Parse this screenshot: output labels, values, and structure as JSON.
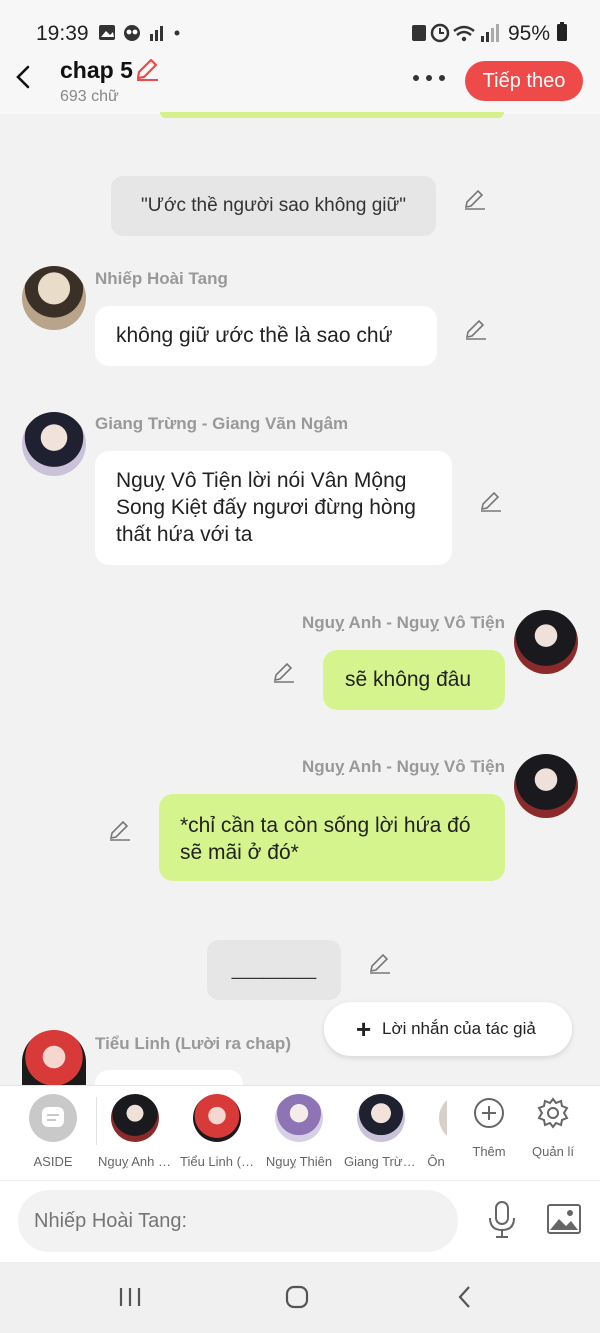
{
  "status_bar": {
    "time": "19:39",
    "battery": "95%"
  },
  "header": {
    "title": "chap 5",
    "word_count": "693 chữ",
    "next_label": "Tiếp theo"
  },
  "messages": [
    {
      "type": "narration",
      "text": "\"Ước thề người sao không giữ\""
    },
    {
      "type": "left",
      "name": "Nhiếp Hoài Tang",
      "text": "không giữ ước thề là sao chứ"
    },
    {
      "type": "left",
      "name": "Giang Trừng - Giang Vãn Ngâm",
      "text": "Nguỵ Vô Tiện lời nói Vân Mộng Song Kiệt đấy ngươi đừng hòng thất hứa với ta"
    },
    {
      "type": "right",
      "name": "Nguỵ Anh - Nguỵ Vô Tiện",
      "text": "sẽ không đâu"
    },
    {
      "type": "right",
      "name": "Nguỵ Anh - Nguỵ Vô Tiện",
      "text": "*chỉ cần ta còn sống lời hứa đó sẽ mãi ở đó*"
    },
    {
      "type": "narration",
      "text": "________"
    },
    {
      "type": "left",
      "name": "Tiểu Linh (Lười ra chap)",
      "text": ""
    }
  ],
  "author_note_label": "Lời nhắn của tác giả",
  "characters": [
    {
      "label": "ASIDE"
    },
    {
      "label": "Nguỵ Anh - Nguỵ Vô Tiện"
    },
    {
      "label": "Tiểu Linh (Lười ra chap)"
    },
    {
      "label": "Nguỵ Thiên"
    },
    {
      "label": "Giang Trừng - Giang Vãn Ngâm"
    },
    {
      "label": "Ôn"
    }
  ],
  "toolbar": {
    "add_label": "Thêm",
    "manage_label": "Quản lí"
  },
  "input": {
    "placeholder": "Nhiếp Hoài Tang:"
  },
  "colors": {
    "accent": "#ee4a4a",
    "right_bubble": "#d6f48d",
    "left_bubble": "#ffffff",
    "narration": "#e6e6e6"
  }
}
